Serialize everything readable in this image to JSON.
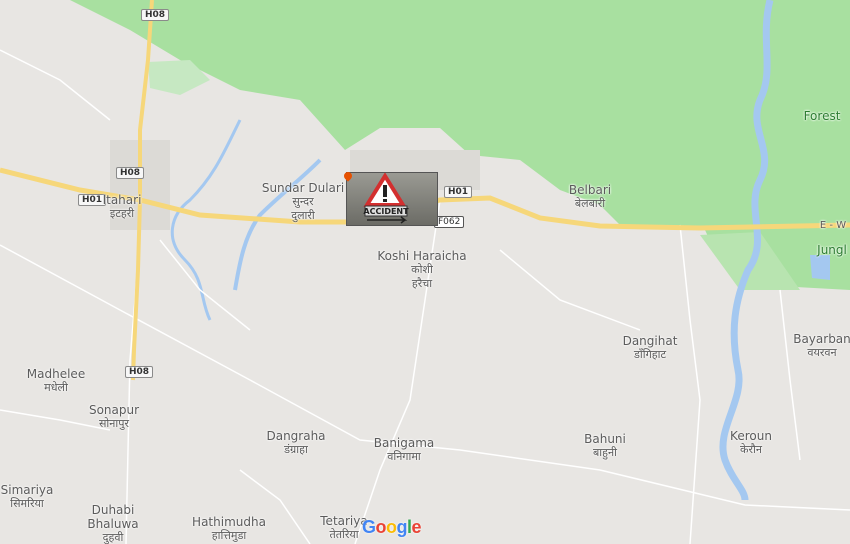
{
  "places": [
    {
      "name": "Itahari",
      "local": "इटहरी",
      "id": "itahari"
    },
    {
      "name": "Sundar Dulari",
      "local": "सुन्दर दुलारी",
      "id": "sundar-dulari"
    },
    {
      "name": "Belbari",
      "local": "बेलबारी",
      "id": "belbari"
    },
    {
      "name": "Koshi Haraicha",
      "local": "कोशी हरैचा",
      "id": "koshi-haraicha"
    },
    {
      "name": "Madhelee",
      "local": "मधेली",
      "id": "madhelee"
    },
    {
      "name": "Sonapur",
      "local": "सोनापुर",
      "id": "sonapur"
    },
    {
      "name": "Dangraha",
      "local": "डंग्राहा",
      "id": "dangraha"
    },
    {
      "name": "Banigama",
      "local": "वनिगामा",
      "id": "banigama"
    },
    {
      "name": "Bahuni",
      "local": "बाहुनी",
      "id": "bahuni"
    },
    {
      "name": "Dangihat",
      "local": "डाँगिहाट",
      "id": "dangihat"
    },
    {
      "name": "Bayarban",
      "local": "वयरवन",
      "id": "bayarban"
    },
    {
      "name": "Keroun",
      "local": "केरौन",
      "id": "keroun"
    },
    {
      "name": "Simariya",
      "local": "सिमरिया",
      "id": "simariya"
    },
    {
      "name": "Duhabi",
      "local": "Bhaluwa",
      "id": "duhabi"
    },
    {
      "name": "Hathimudha",
      "local": "हात्तिमुडा",
      "id": "hathimudha"
    },
    {
      "name": "Tetariya",
      "local": "तेतरिया",
      "id": "tetariya"
    }
  ],
  "duhabi_extra": "दुहवी",
  "area_labels": {
    "forest": "Forest",
    "jungle": "Jungl",
    "ew": "E - W"
  },
  "shields": {
    "h08_top": "H08",
    "h08_mid": "H08",
    "h08_low": "H08",
    "h01_left": "H01",
    "h01_center": "H01",
    "f062": "F062"
  },
  "accident_text": "ACCIDENT",
  "google": [
    "G",
    "o",
    "o",
    "g",
    "l",
    "e"
  ],
  "colors": {
    "land": "#e8e6e3",
    "forest": "#a8e0a0",
    "water": "#a4c8f0",
    "road": "#f6d77a",
    "minor_road": "#ffffff",
    "google": [
      "#4285F4",
      "#EA4335",
      "#FBBC05",
      "#4285F4",
      "#34A853",
      "#EA4335"
    ]
  }
}
